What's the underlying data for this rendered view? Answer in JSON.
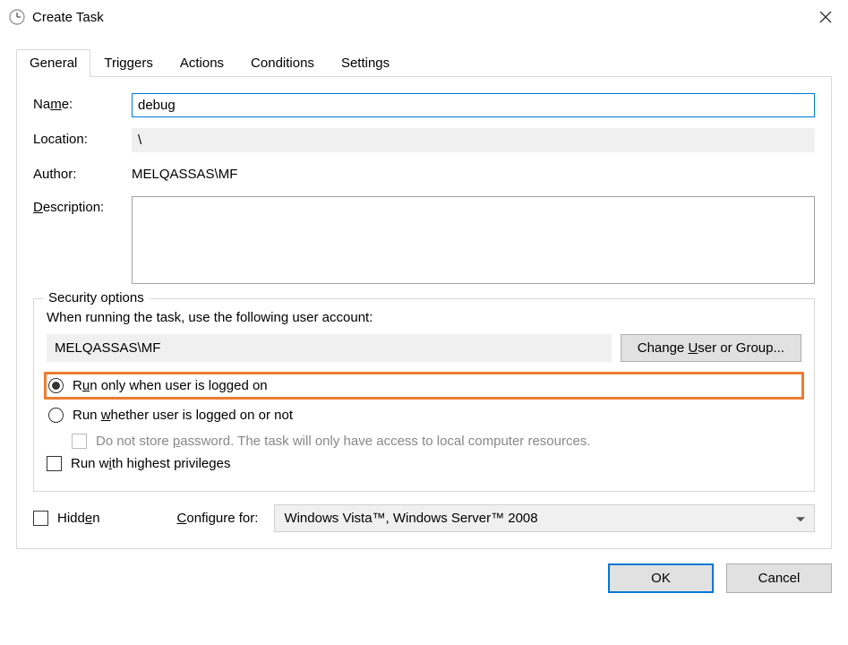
{
  "window": {
    "title": "Create Task"
  },
  "tabs": [
    "General",
    "Triggers",
    "Actions",
    "Conditions",
    "Settings"
  ],
  "activeTab": 0,
  "form": {
    "nameLabel": "Name:",
    "nameValue": "debug",
    "locationLabel": "Location:",
    "locationValue": "\\",
    "authorLabel": "Author:",
    "authorValue": "MELQASSAS\\MF",
    "descriptionLabel": "Description:",
    "descriptionValue": ""
  },
  "security": {
    "legend": "Security options",
    "whenRunningText": "When running the task, use the following user account:",
    "account": "MELQASSAS\\MF",
    "changeUserBtn": "Change User or Group...",
    "runOnlyLabel": "Run only when user is logged on",
    "runWhetherLabel": "Run whether user is logged on or not",
    "doNotStoreLabel": "Do not store password.  The task will only have access to local computer resources.",
    "runHighestLabel": "Run with highest privileges"
  },
  "bottom": {
    "hiddenLabel": "Hidden",
    "configureLabel": "Configure for:",
    "configureValue": "Windows Vista™, Windows Server™ 2008"
  },
  "buttons": {
    "ok": "OK",
    "cancel": "Cancel"
  }
}
